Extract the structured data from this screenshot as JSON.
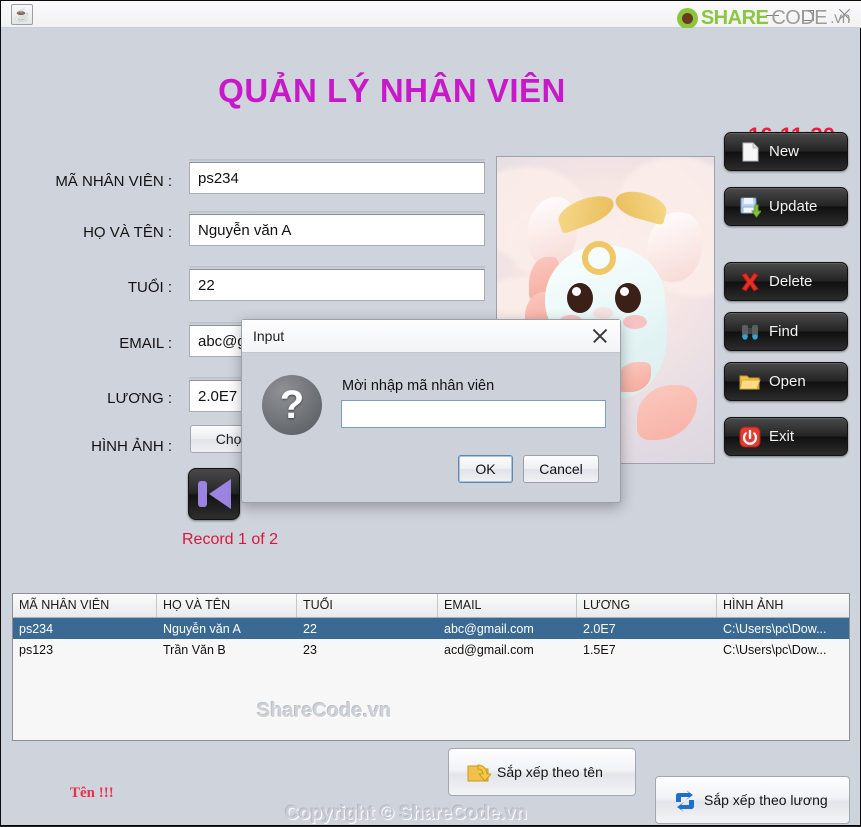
{
  "window": {
    "app_icon": "java-coffee-icon",
    "minimize_label": "Minimize",
    "maximize_label": "Maximize",
    "close_label": "Close"
  },
  "brand": {
    "share": "SHARE",
    "code": "CODE",
    "vn": ".vn",
    "mark_color": "#8cc63f"
  },
  "header": {
    "title": "QUẢN LÝ NHÂN VIÊN",
    "title_color": "#c918c9",
    "clock": "16:11:30",
    "clock_color": "#ec1c3a"
  },
  "form": {
    "fields": [
      {
        "label": "MÃ NHÂN VIÊN :",
        "value": "ps234"
      },
      {
        "label": "HỌ VÀ TÊN :",
        "value": "Nguyễn văn A"
      },
      {
        "label": "TUỔI :",
        "value": "22"
      },
      {
        "label": "EMAIL :",
        "value": "abc@gmail.com"
      },
      {
        "label": "LƯƠNG :",
        "value": "2.0E7"
      },
      {
        "label": "HÌNH ẢNH :",
        "value": ""
      }
    ],
    "choose_button": "Chọn",
    "record_status": "Record 1 of 2",
    "record_status_color": "#d8173c",
    "nav_first_label": "First record"
  },
  "actions": [
    {
      "label": "New",
      "icon": "new-document-icon"
    },
    {
      "label": "Update",
      "icon": "save-disk-icon"
    },
    {
      "label": "Delete",
      "icon": "red-x-icon"
    },
    {
      "label": "Find",
      "icon": "binoculars-icon"
    },
    {
      "label": "Open",
      "icon": "folder-icon"
    },
    {
      "label": "Exit",
      "icon": "power-icon"
    }
  ],
  "table": {
    "columns": [
      "MÃ NHÂN VIÊN",
      "HỌ VÀ TÊN",
      "TUỔI",
      "EMAIL",
      "LƯƠNG",
      "HÌNH ẢNH"
    ],
    "rows": [
      {
        "selected": true,
        "cells": [
          "ps234",
          "Nguyễn văn A",
          "22",
          "abc@gmail.com",
          "2.0E7",
          "C:\\Users\\pc\\Dow..."
        ]
      },
      {
        "selected": false,
        "cells": [
          "ps123",
          "Trần Văn B",
          "23",
          "acd@gmail.com",
          "1.5E7",
          "C:\\Users\\pc\\Dow..."
        ]
      }
    ],
    "selection_color": "#3a6a94",
    "watermark": "ShareCode.vn"
  },
  "footer": {
    "validation_message": "Tên !!!",
    "validation_color": "#e8314f",
    "copyright_watermark": "Copyright © ShareCode.vn",
    "sort_by_name": "Sắp xếp theo tên",
    "sort_by_salary": "Sắp xếp theo lương"
  },
  "dialog": {
    "title": "Input",
    "message": "Mời nhập mã nhân viên",
    "input_value": "",
    "input_placeholder": "",
    "ok_label": "OK",
    "cancel_label": "Cancel",
    "icon": "question-mark-icon",
    "close_icon": "close-icon"
  },
  "picture": {
    "alt": "baby-dragon-illustration"
  }
}
